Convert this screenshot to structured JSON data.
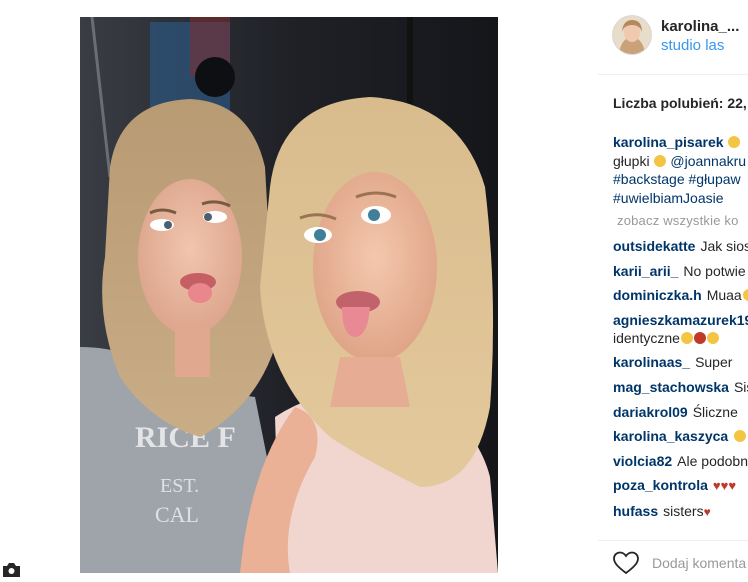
{
  "post": {
    "username": "karolina_...",
    "location": "studio las",
    "likes_text": "Liczba polubień: 22,"
  },
  "caption": {
    "username": "karolina_pisarek",
    "line2_text": "głupki",
    "mention": "@joannakru",
    "hashtag1": "#backstage",
    "hashtag2": "#głupaw",
    "hashtag3": "#uwielbiamJoasie"
  },
  "view_all_label": "zobacz wszystkie ko",
  "comments": [
    {
      "user": "outsidekatte",
      "text": "Jak sios"
    },
    {
      "user": "karii_arii_",
      "text": "No potwie"
    },
    {
      "user": "dominiczka.h",
      "text": "Muaa"
    },
    {
      "user": "agnieszkamazurek19",
      "text": "identyczne"
    },
    {
      "user": "karolinaas_",
      "text": "Super"
    },
    {
      "user": "mag_stachowska",
      "text": "Sis"
    },
    {
      "user": "dariakrol09",
      "text": "Śliczne"
    },
    {
      "user": "karolina_kaszyca",
      "text": ""
    },
    {
      "user": "violcia82",
      "text": "Ale podobn"
    },
    {
      "user": "poza_kontrola",
      "text": ""
    },
    {
      "user": "hufass",
      "text": "sisters"
    }
  ],
  "footer": {
    "add_comment_placeholder": "Dodaj komenta"
  },
  "icons": {
    "like": "heart-outline-icon",
    "corner": "camera-icon"
  },
  "colors": {
    "username": "#003569",
    "location": "#3897f0",
    "muted": "#999999",
    "heart_emoji": "#ed4956"
  }
}
